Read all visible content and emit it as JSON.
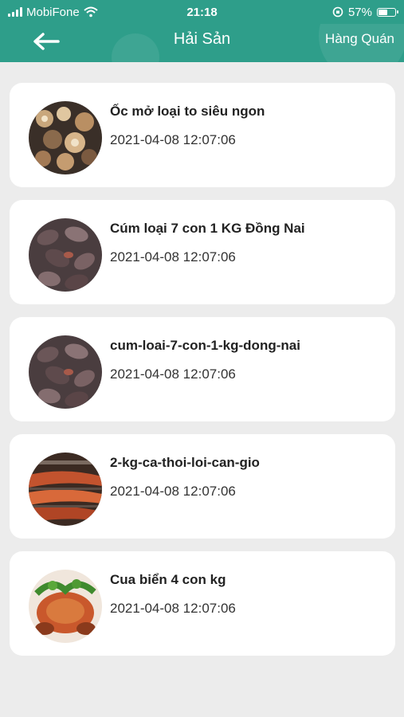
{
  "status_bar": {
    "carrier": "MobiFone",
    "time": "21:18",
    "battery": "57%",
    "battery_level": 0.57
  },
  "header": {
    "title": "Hải Sản",
    "right_action": "Hàng Quán",
    "back_icon": "arrow-left-icon",
    "background": "#2e9e8a"
  },
  "items": [
    {
      "name": "Ốc mở loại to siêu ngon",
      "date": "2021-04-08 12:07:06",
      "image": "snails-photo"
    },
    {
      "name": "Cúm loại 7 con 1 KG Đồng Nai",
      "date": "2021-04-08 12:07:06",
      "image": "clams-photo"
    },
    {
      "name": "cum-loai-7-con-1-kg-dong-nai",
      "date": "2021-04-08 12:07:06",
      "image": "clams-photo"
    },
    {
      "name": "2-kg-ca-thoi-loi-can-gio",
      "date": "2021-04-08 12:07:06",
      "image": "grilled-fish-photo"
    },
    {
      "name": "Cua biển 4 con kg",
      "date": "2021-04-08 12:07:06",
      "image": "crab-photo"
    }
  ]
}
